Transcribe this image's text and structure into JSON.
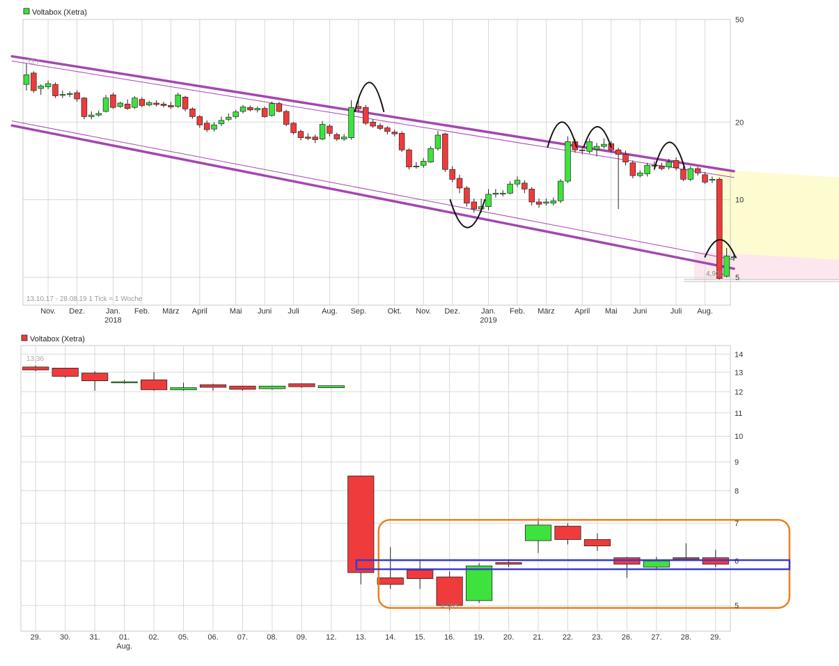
{
  "colors": {
    "up": "#3de23d",
    "down": "#ef3b3b",
    "grid": "#d8d8d8",
    "channel": "#a347b0",
    "yellow_zone": "#fdfbd0",
    "pink_zone": "#fde7ee",
    "orange_box": "#f07d1a",
    "blue_box": "#3a3ad0",
    "axis_text": "#333333",
    "muted_text": "#999999"
  },
  "chart_data": [
    {
      "type": "candlestick",
      "legend": "Voltabox (Xetra)",
      "legend_position": "top-left",
      "info_text": "13.10.17 - 28.08.19   1 Tick = 1 Woche",
      "y_scale": "log",
      "y_ticks": [
        5,
        10,
        20,
        50
      ],
      "ylim": [
        3.9,
        50
      ],
      "xlim": [
        0,
        98
      ],
      "max_label": "33,7",
      "min_label": "4,905",
      "grid": true,
      "x_month_labels": [
        {
          "label": "Nov.",
          "x": 3
        },
        {
          "label": "Dez.",
          "x": 7
        },
        {
          "label": "Jan.",
          "x": 12,
          "year": "2018"
        },
        {
          "label": "Feb.",
          "x": 16
        },
        {
          "label": "März",
          "x": 20
        },
        {
          "label": "April",
          "x": 24
        },
        {
          "label": "Mai",
          "x": 29
        },
        {
          "label": "Juni",
          "x": 33
        },
        {
          "label": "Juli",
          "x": 37
        },
        {
          "label": "Aug.",
          "x": 42
        },
        {
          "label": "Sep.",
          "x": 46
        },
        {
          "label": "Okt.",
          "x": 51
        },
        {
          "label": "Nov.",
          "x": 55
        },
        {
          "label": "Dez.",
          "x": 59
        },
        {
          "label": "Jan.",
          "x": 64,
          "year": "2019"
        },
        {
          "label": "Feb.",
          "x": 68
        },
        {
          "label": "März",
          "x": 72
        },
        {
          "label": "April",
          "x": 77
        },
        {
          "label": "Mai",
          "x": 81
        },
        {
          "label": "Juni",
          "x": 85
        },
        {
          "label": "Juli",
          "x": 90
        },
        {
          "label": "Aug.",
          "x": 94
        }
      ],
      "candles": [
        {
          "o": 28.0,
          "c": 30.5,
          "h": 33.7,
          "l": 26.5
        },
        {
          "o": 31.0,
          "c": 26.5,
          "h": 31.5,
          "l": 26.0
        },
        {
          "o": 27.0,
          "c": 27.6,
          "h": 28.0,
          "l": 25.5
        },
        {
          "o": 27.4,
          "c": 28.2,
          "h": 29.0,
          "l": 26.8
        },
        {
          "o": 28.0,
          "c": 25.3,
          "h": 28.5,
          "l": 24.8
        },
        {
          "o": 25.4,
          "c": 25.6,
          "h": 26.5,
          "l": 24.8
        },
        {
          "o": 25.6,
          "c": 25.8,
          "h": 26.3,
          "l": 25.0
        },
        {
          "o": 26.0,
          "c": 24.6,
          "h": 26.6,
          "l": 24.0
        },
        {
          "o": 24.8,
          "c": 21.0,
          "h": 25.0,
          "l": 20.5
        },
        {
          "o": 21.0,
          "c": 21.3,
          "h": 22.0,
          "l": 20.5
        },
        {
          "o": 21.3,
          "c": 21.6,
          "h": 22.2,
          "l": 21.0
        },
        {
          "o": 22.0,
          "c": 24.8,
          "h": 25.5,
          "l": 21.8
        },
        {
          "o": 25.5,
          "c": 22.8,
          "h": 26.0,
          "l": 22.5
        },
        {
          "o": 23.0,
          "c": 23.7,
          "h": 24.0,
          "l": 22.7
        },
        {
          "o": 23.5,
          "c": 22.6,
          "h": 24.5,
          "l": 22.3
        },
        {
          "o": 22.8,
          "c": 24.8,
          "h": 25.2,
          "l": 22.5
        },
        {
          "o": 24.5,
          "c": 23.2,
          "h": 25.0,
          "l": 22.8
        },
        {
          "o": 23.3,
          "c": 23.8,
          "h": 24.2,
          "l": 23.0
        },
        {
          "o": 23.7,
          "c": 23.4,
          "h": 24.3,
          "l": 23.0
        },
        {
          "o": 23.5,
          "c": 23.2,
          "h": 24.0,
          "l": 22.8
        },
        {
          "o": 23.2,
          "c": 22.9,
          "h": 24.0,
          "l": 22.5
        },
        {
          "o": 23.0,
          "c": 25.5,
          "h": 26.0,
          "l": 22.7
        },
        {
          "o": 25.0,
          "c": 22.5,
          "h": 25.3,
          "l": 22.0
        },
        {
          "o": 22.5,
          "c": 21.0,
          "h": 22.8,
          "l": 20.6
        },
        {
          "o": 21.0,
          "c": 19.5,
          "h": 21.3,
          "l": 19.0
        },
        {
          "o": 19.8,
          "c": 18.7,
          "h": 20.3,
          "l": 18.3
        },
        {
          "o": 18.8,
          "c": 19.5,
          "h": 20.0,
          "l": 18.4
        },
        {
          "o": 19.7,
          "c": 20.3,
          "h": 21.0,
          "l": 19.3
        },
        {
          "o": 20.5,
          "c": 20.9,
          "h": 21.6,
          "l": 20.2
        },
        {
          "o": 21.0,
          "c": 21.9,
          "h": 22.3,
          "l": 20.6
        },
        {
          "o": 22.0,
          "c": 22.9,
          "h": 23.3,
          "l": 21.6
        },
        {
          "o": 22.8,
          "c": 22.3,
          "h": 23.2,
          "l": 22.0
        },
        {
          "o": 22.3,
          "c": 22.6,
          "h": 23.0,
          "l": 21.8
        },
        {
          "o": 22.6,
          "c": 21.0,
          "h": 23.0,
          "l": 20.8
        },
        {
          "o": 21.2,
          "c": 23.6,
          "h": 24.0,
          "l": 21.0
        },
        {
          "o": 23.6,
          "c": 22.0,
          "h": 24.0,
          "l": 21.8
        },
        {
          "o": 22.0,
          "c": 19.6,
          "h": 22.3,
          "l": 19.3
        },
        {
          "o": 19.8,
          "c": 18.2,
          "h": 20.0,
          "l": 17.9
        },
        {
          "o": 18.4,
          "c": 17.4,
          "h": 18.7,
          "l": 17.0
        },
        {
          "o": 17.5,
          "c": 17.3,
          "h": 18.1,
          "l": 17.0
        },
        {
          "o": 17.5,
          "c": 17.1,
          "h": 17.9,
          "l": 16.6
        },
        {
          "o": 17.2,
          "c": 19.6,
          "h": 20.2,
          "l": 17.0
        },
        {
          "o": 19.3,
          "c": 18.1,
          "h": 19.6,
          "l": 17.6
        },
        {
          "o": 17.9,
          "c": 17.2,
          "h": 18.2,
          "l": 16.9
        },
        {
          "o": 17.2,
          "c": 17.5,
          "h": 18.0,
          "l": 16.9
        },
        {
          "o": 17.4,
          "c": 22.8,
          "h": 24.3,
          "l": 17.1
        },
        {
          "o": 23.0,
          "c": 22.5,
          "h": 24.5,
          "l": 22.0
        },
        {
          "o": 22.8,
          "c": 19.8,
          "h": 23.3,
          "l": 19.5
        },
        {
          "o": 20.0,
          "c": 19.3,
          "h": 20.5,
          "l": 19.0
        },
        {
          "o": 19.4,
          "c": 18.9,
          "h": 19.8,
          "l": 18.6
        },
        {
          "o": 19.0,
          "c": 18.4,
          "h": 19.3,
          "l": 17.9
        },
        {
          "o": 18.3,
          "c": 18.0,
          "h": 18.7,
          "l": 17.6
        },
        {
          "o": 18.1,
          "c": 15.6,
          "h": 18.4,
          "l": 15.3
        },
        {
          "o": 15.6,
          "c": 13.4,
          "h": 15.8,
          "l": 13.1
        },
        {
          "o": 13.5,
          "c": 13.5,
          "h": 14.0,
          "l": 13.2
        },
        {
          "o": 13.6,
          "c": 14.1,
          "h": 14.5,
          "l": 13.3
        },
        {
          "o": 14.0,
          "c": 15.8,
          "h": 16.1,
          "l": 13.9
        },
        {
          "o": 15.8,
          "c": 17.8,
          "h": 18.5,
          "l": 15.5
        },
        {
          "o": 18.0,
          "c": 13.1,
          "h": 18.2,
          "l": 12.8
        },
        {
          "o": 13.1,
          "c": 12.0,
          "h": 13.5,
          "l": 11.7
        },
        {
          "o": 12.1,
          "c": 11.1,
          "h": 12.5,
          "l": 10.6
        },
        {
          "o": 11.1,
          "c": 9.7,
          "h": 11.3,
          "l": 9.4
        },
        {
          "o": 9.8,
          "c": 9.2,
          "h": 10.1,
          "l": 8.9
        },
        {
          "o": 9.2,
          "c": 9.4,
          "h": 10.1,
          "l": 8.9
        },
        {
          "o": 9.4,
          "c": 10.5,
          "h": 11.0,
          "l": 9.1
        },
        {
          "o": 10.5,
          "c": 10.6,
          "h": 11.0,
          "l": 10.2
        },
        {
          "o": 10.6,
          "c": 10.6,
          "h": 10.9,
          "l": 10.3
        },
        {
          "o": 10.6,
          "c": 11.5,
          "h": 11.8,
          "l": 10.5
        },
        {
          "o": 11.5,
          "c": 11.9,
          "h": 12.3,
          "l": 11.2
        },
        {
          "o": 11.6,
          "c": 11.0,
          "h": 11.9,
          "l": 10.6
        },
        {
          "o": 11.0,
          "c": 9.8,
          "h": 11.2,
          "l": 9.5
        },
        {
          "o": 9.8,
          "c": 9.6,
          "h": 10.1,
          "l": 9.3
        },
        {
          "o": 9.7,
          "c": 9.8,
          "h": 10.1,
          "l": 9.5
        },
        {
          "o": 9.7,
          "c": 9.9,
          "h": 10.2,
          "l": 9.5
        },
        {
          "o": 9.9,
          "c": 11.8,
          "h": 12.0,
          "l": 9.7
        },
        {
          "o": 11.8,
          "c": 16.8,
          "h": 17.6,
          "l": 11.6
        },
        {
          "o": 16.8,
          "c": 15.6,
          "h": 17.2,
          "l": 15.2
        },
        {
          "o": 15.6,
          "c": 15.5,
          "h": 16.1,
          "l": 15.0
        },
        {
          "o": 15.4,
          "c": 16.8,
          "h": 17.3,
          "l": 15.1
        },
        {
          "o": 15.7,
          "c": 16.1,
          "h": 16.6,
          "l": 14.7
        },
        {
          "o": 16.1,
          "c": 16.4,
          "h": 17.3,
          "l": 15.8
        },
        {
          "o": 16.5,
          "c": 15.6,
          "h": 16.9,
          "l": 15.2
        },
        {
          "o": 15.6,
          "c": 15.0,
          "h": 15.9,
          "l": 9.2
        },
        {
          "o": 15.0,
          "c": 14.0,
          "h": 15.5,
          "l": 13.6
        },
        {
          "o": 13.9,
          "c": 12.4,
          "h": 14.2,
          "l": 12.1
        },
        {
          "o": 12.4,
          "c": 12.7,
          "h": 13.0,
          "l": 12.2
        },
        {
          "o": 12.6,
          "c": 13.6,
          "h": 13.9,
          "l": 12.3
        },
        {
          "o": 13.6,
          "c": 13.5,
          "h": 14.1,
          "l": 13.0
        },
        {
          "o": 13.5,
          "c": 13.2,
          "h": 13.9,
          "l": 13.0
        },
        {
          "o": 13.4,
          "c": 14.0,
          "h": 14.4,
          "l": 13.1
        },
        {
          "o": 14.2,
          "c": 13.3,
          "h": 14.6,
          "l": 13.0
        },
        {
          "o": 13.1,
          "c": 12.0,
          "h": 13.4,
          "l": 11.8
        },
        {
          "o": 12.0,
          "c": 13.2,
          "h": 13.5,
          "l": 11.8
        },
        {
          "o": 13.2,
          "c": 12.7,
          "h": 13.4,
          "l": 12.4
        },
        {
          "o": 12.5,
          "c": 11.7,
          "h": 12.8,
          "l": 11.5
        },
        {
          "o": 11.9,
          "c": 12.0,
          "h": 12.3,
          "l": 11.6
        },
        {
          "o": 12.0,
          "c": 4.95,
          "h": 12.2,
          "l": 4.905
        },
        {
          "o": 5.05,
          "c": 6.05,
          "h": 6.5,
          "l": 5.0
        },
        {
          "o": 5.95,
          "c": 6.0,
          "h": 6.2,
          "l": 5.8
        }
      ],
      "annotations": {
        "channel_upper": [
          [
            -2,
            36.0
          ],
          [
            98,
            12.9
          ]
        ],
        "channel_upper_inner": [
          [
            -2,
            34.5
          ],
          [
            98,
            12.2
          ]
        ],
        "channel_lower": [
          [
            -2,
            19.4
          ],
          [
            98,
            5.4
          ]
        ],
        "channel_lower_inner": [
          [
            -2,
            20.2
          ],
          [
            98,
            5.85
          ]
        ],
        "yellow_zone": {
          "x_from": 95.5,
          "top": [
            13.1,
            12.2
          ],
          "bottom": [
            6.1,
            5.85
          ]
        },
        "pink_zone": {
          "x_from": 92.5,
          "top": [
            6.3,
            5.85
          ],
          "bottom": [
            4.905,
            4.905
          ]
        },
        "min_line": 4.905,
        "arcs": [
          {
            "x1": 45.5,
            "x2": 49.5,
            "peak": 28.5,
            "base": 22.0,
            "dir": "up"
          },
          {
            "x1": 58.7,
            "x2": 63.5,
            "peak": 7.8,
            "base": 10.0,
            "dir": "down"
          },
          {
            "x1": 72.2,
            "x2": 76.2,
            "peak": 20.0,
            "base": 16.0,
            "dir": "up"
          },
          {
            "x1": 77.2,
            "x2": 81.0,
            "peak": 19.2,
            "base": 16.0,
            "dir": "up"
          },
          {
            "x1": 87.0,
            "x2": 91.2,
            "peak": 16.7,
            "base": 13.2,
            "dir": "up"
          },
          {
            "x1": 94.0,
            "x2": 98.2,
            "peak": 7.0,
            "base": 6.0,
            "dir": "up"
          }
        ]
      }
    },
    {
      "type": "candlestick",
      "legend": "Voltabox (Xetra)",
      "legend_position": "top-left",
      "y_scale": "log",
      "y_ticks": [
        5,
        6,
        7,
        8,
        9,
        10,
        11,
        12,
        13,
        14
      ],
      "ylim": [
        4.5,
        14.5
      ],
      "max_label": "13,36",
      "min_label": "4,905",
      "grid": true,
      "x_labels": [
        "29.",
        "30.",
        "31.",
        "01.",
        "02.",
        "05.",
        "06.",
        "07.",
        "08.",
        "09.",
        "12.",
        "13.",
        "14.",
        "15.",
        "16.",
        "19.",
        "20.",
        "21.",
        "22.",
        "23.",
        "26.",
        "27.",
        "28.",
        "29."
      ],
      "x_sub_labels": [
        {
          "index": 3,
          "label": "Aug."
        }
      ],
      "candles": [
        {
          "o": 13.28,
          "c": 13.12,
          "h": 13.36,
          "l": 13.05
        },
        {
          "o": 13.22,
          "c": 12.78,
          "h": 13.22,
          "l": 12.7
        },
        {
          "o": 12.95,
          "c": 12.55,
          "h": 13.05,
          "l": 12.05
        },
        {
          "o": 12.5,
          "c": 12.5,
          "h": 12.6,
          "l": 12.4
        },
        {
          "o": 12.6,
          "c": 12.1,
          "h": 13.0,
          "l": 12.05
        },
        {
          "o": 12.1,
          "c": 12.2,
          "h": 12.45,
          "l": 12.05
        },
        {
          "o": 12.35,
          "c": 12.22,
          "h": 12.4,
          "l": 12.05
        },
        {
          "o": 12.28,
          "c": 12.12,
          "h": 12.3,
          "l": 12.05
        },
        {
          "o": 12.15,
          "c": 12.28,
          "h": 12.3,
          "l": 12.1
        },
        {
          "o": 12.4,
          "c": 12.25,
          "h": 12.4,
          "l": 12.2
        },
        {
          "o": 12.2,
          "c": 12.3,
          "h": 12.3,
          "l": 12.2
        },
        {
          "o": 8.5,
          "c": 5.72,
          "h": 8.5,
          "l": 5.45
        },
        {
          "o": 5.6,
          "c": 5.45,
          "h": 6.35,
          "l": 5.35
        },
        {
          "o": 5.78,
          "c": 5.58,
          "h": 6.0,
          "l": 5.35
        },
        {
          "o": 5.62,
          "c": 5.0,
          "h": 5.75,
          "l": 4.905
        },
        {
          "o": 5.1,
          "c": 5.88,
          "h": 5.95,
          "l": 5.05
        },
        {
          "o": 5.96,
          "c": 5.92,
          "h": 6.02,
          "l": 5.85
        },
        {
          "o": 6.52,
          "c": 6.95,
          "h": 7.15,
          "l": 6.2
        },
        {
          "o": 6.92,
          "c": 6.55,
          "h": 7.0,
          "l": 6.42
        },
        {
          "o": 6.55,
          "c": 6.38,
          "h": 6.72,
          "l": 6.25
        },
        {
          "o": 6.08,
          "c": 5.92,
          "h": 6.1,
          "l": 5.6
        },
        {
          "o": 5.85,
          "c": 6.0,
          "h": 6.1,
          "l": 5.8
        },
        {
          "o": 6.08,
          "c": 6.05,
          "h": 6.45,
          "l": 6.02
        },
        {
          "o": 6.08,
          "c": 5.92,
          "h": 6.28,
          "l": 5.85
        }
      ],
      "annotations": {
        "orange_box": {
          "from_index": 11.6,
          "to_index": 25.5,
          "top": 7.1,
          "bottom": 4.95
        },
        "blue_box": {
          "from_index": 10.85,
          "to_index": 25.5,
          "top": 6.02,
          "bottom": 5.8
        }
      }
    }
  ]
}
